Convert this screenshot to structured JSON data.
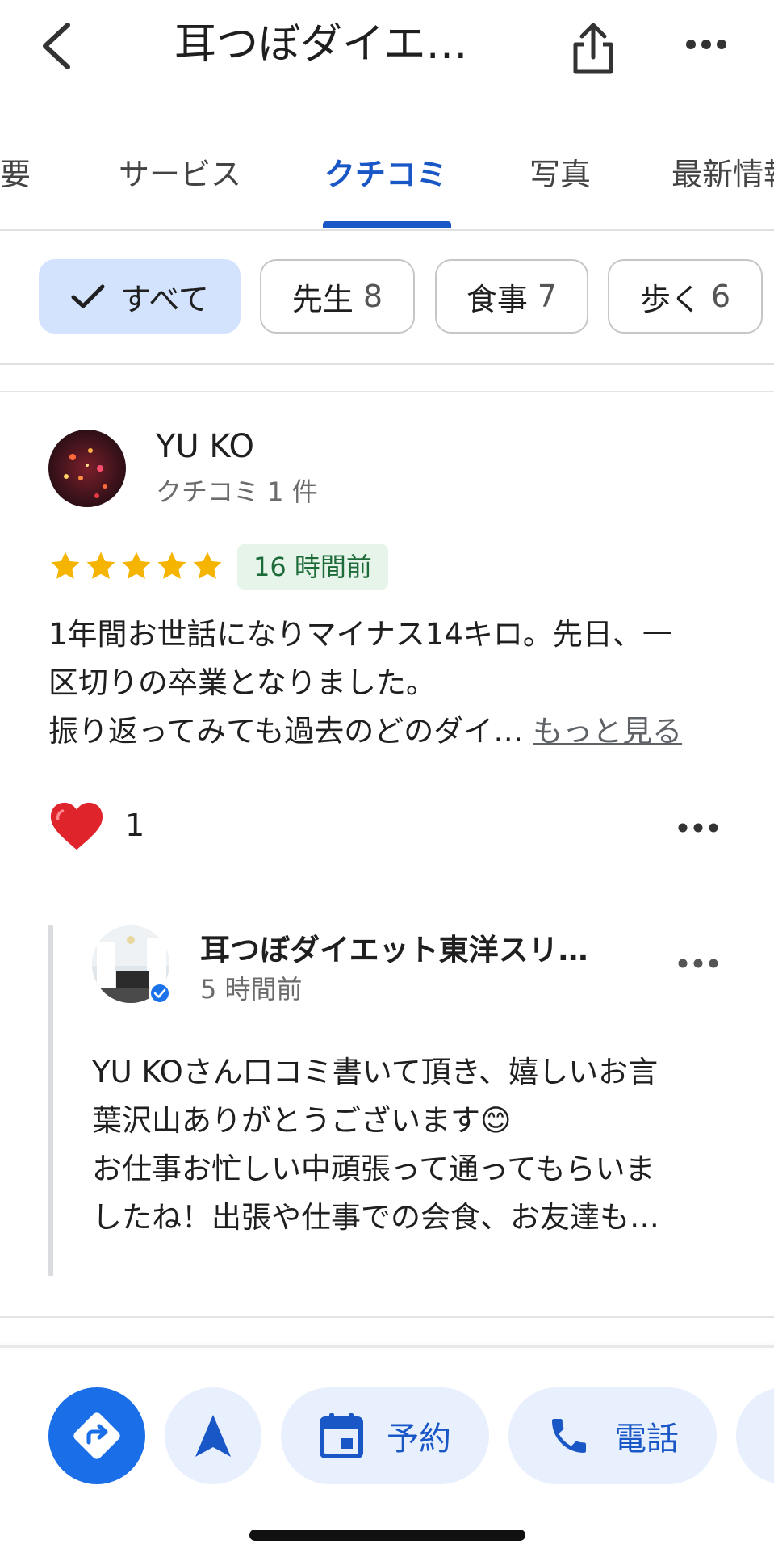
{
  "header": {
    "title": "耳つぼダイエ…"
  },
  "tabs": [
    {
      "label": "概要"
    },
    {
      "label": "サービス"
    },
    {
      "label": "クチコミ"
    },
    {
      "label": "写真"
    },
    {
      "label": "最新情報"
    }
  ],
  "chips": [
    {
      "label": "すべて",
      "count": ""
    },
    {
      "label": "先生",
      "count": "8"
    },
    {
      "label": "食事",
      "count": "7"
    },
    {
      "label": "歩く",
      "count": "6"
    }
  ],
  "review": {
    "author": "YU KO",
    "meta": "クチコミ 1 件",
    "rating": 5,
    "time": "16 時間前",
    "text_line1": "1年間お世話になりマイナス14キロ。先日、一",
    "text_line2": "区切りの卒業となりました。",
    "text_line3": "振り返ってみても過去のどのダイ…",
    "more_label": "もっと見る",
    "likes": "1"
  },
  "owner_reply": {
    "name": "耳つぼダイエット東洋スリ…",
    "time": "5 時間前",
    "line1": "YU KOさん口コミ書いて頂き、嬉しいお言",
    "line2": "葉沢山ありがとうございます😊",
    "line3": "お仕事お忙しい中頑張って通ってもらいま",
    "line4": "したね！出張や仕事での会食、お友達も…"
  },
  "actions": [
    {
      "icon": "directions-icon"
    },
    {
      "icon": "navigation-arrow-icon"
    },
    {
      "icon": "calendar-icon",
      "label": "予約"
    },
    {
      "icon": "phone-icon",
      "label": "電話"
    }
  ],
  "colors": {
    "accent": "#1a57c6",
    "star": "#f4b400",
    "badge_bg": "#e6f4ea",
    "chip_selected": "#d3e3fd"
  }
}
